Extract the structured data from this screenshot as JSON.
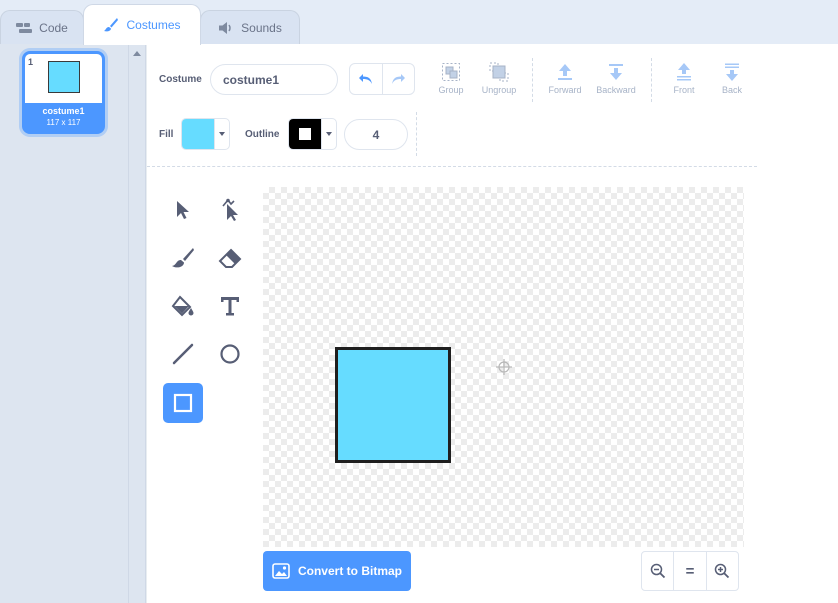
{
  "tabs": [
    {
      "label": "Code",
      "icon": "code-icon"
    },
    {
      "label": "Costumes",
      "icon": "brush-icon"
    },
    {
      "label": "Sounds",
      "icon": "speaker-icon"
    }
  ],
  "costume_list": [
    {
      "number": "1",
      "name": "costume1",
      "size": "117 x 117"
    }
  ],
  "toolbar": {
    "costume_label": "Costume",
    "costume_name": "costume1",
    "group_label": "Group",
    "ungroup_label": "Ungroup",
    "forward_label": "Forward",
    "backward_label": "Backward",
    "front_label": "Front",
    "back_label": "Back",
    "fill_label": "Fill",
    "outline_label": "Outline",
    "outline_width": "4"
  },
  "colors": {
    "accent": "#4c97ff",
    "fill": "#66dcff",
    "outline": "#000000"
  },
  "tools": [
    "select-icon",
    "reshape-icon",
    "brush-icon",
    "eraser-icon",
    "fill-icon",
    "text-icon",
    "line-icon",
    "circle-icon",
    "rectangle-icon"
  ],
  "active_tool": "rectangle-icon",
  "footer": {
    "convert_label": "Convert to Bitmap",
    "zoom_reset": "="
  }
}
